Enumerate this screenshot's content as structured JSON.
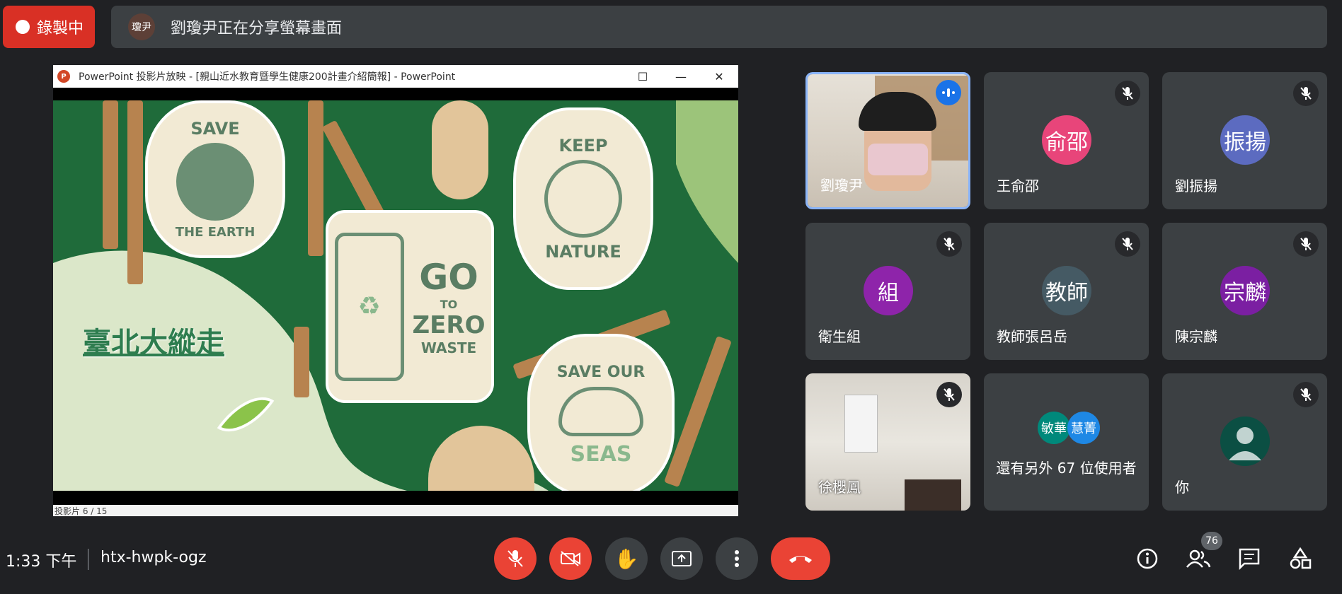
{
  "recording": {
    "label": "錄製中"
  },
  "banner": {
    "avatar_initials": "瓊尹",
    "text": "劉瓊尹正在分享螢幕畫面"
  },
  "presentation": {
    "window_title": "PowerPoint 投影片放映 - [親山近水教育暨學生健康200計畫介紹簡報] - PowerPoint",
    "slide_title": "臺北大縱走",
    "slide_status": "投影片 6 / 15",
    "stickers": {
      "save_earth_top": "SAVE",
      "save_earth_bottom": "THE EARTH",
      "keep_nature_top": "KEEP",
      "keep_nature_bottom": "NATURE",
      "go": "GO",
      "to": "TO",
      "zero": "ZERO",
      "waste": "WASTE",
      "save_our": "SAVE OUR",
      "seas": "SEAS"
    }
  },
  "participants": [
    {
      "name": "劉瓊尹",
      "type": "video",
      "speaking": true
    },
    {
      "name": "王俞邵",
      "initials": "俞邵",
      "color": "#e8457a",
      "muted": true
    },
    {
      "name": "劉振揚",
      "initials": "振揚",
      "color": "#5c6bc0",
      "muted": true
    },
    {
      "name": "衛生組",
      "initials": "組",
      "color": "#8e24aa",
      "muted": true
    },
    {
      "name": "教師張呂岳",
      "initials": "教師",
      "color": "#455a64",
      "muted": true
    },
    {
      "name": "陳宗麟",
      "initials": "宗麟",
      "color": "#7b1fa2",
      "muted": true
    },
    {
      "name": "徐櫻鳳",
      "type": "video",
      "muted": true
    },
    {
      "others_label": "還有另外 67 位使用者",
      "avatars": [
        {
          "initials": "敏華",
          "color": "#00897b"
        },
        {
          "initials": "慧菁",
          "color": "#1e88e5"
        }
      ]
    },
    {
      "name": "你",
      "type": "self",
      "muted": true
    }
  ],
  "bottom": {
    "time": "1:33 下午",
    "meeting_code": "htx-hwpk-ogz",
    "participant_count": "76"
  },
  "colors": {
    "danger": "#ea4335",
    "background": "#202124",
    "tile": "#3c4043",
    "accent": "#8ab4f8"
  }
}
